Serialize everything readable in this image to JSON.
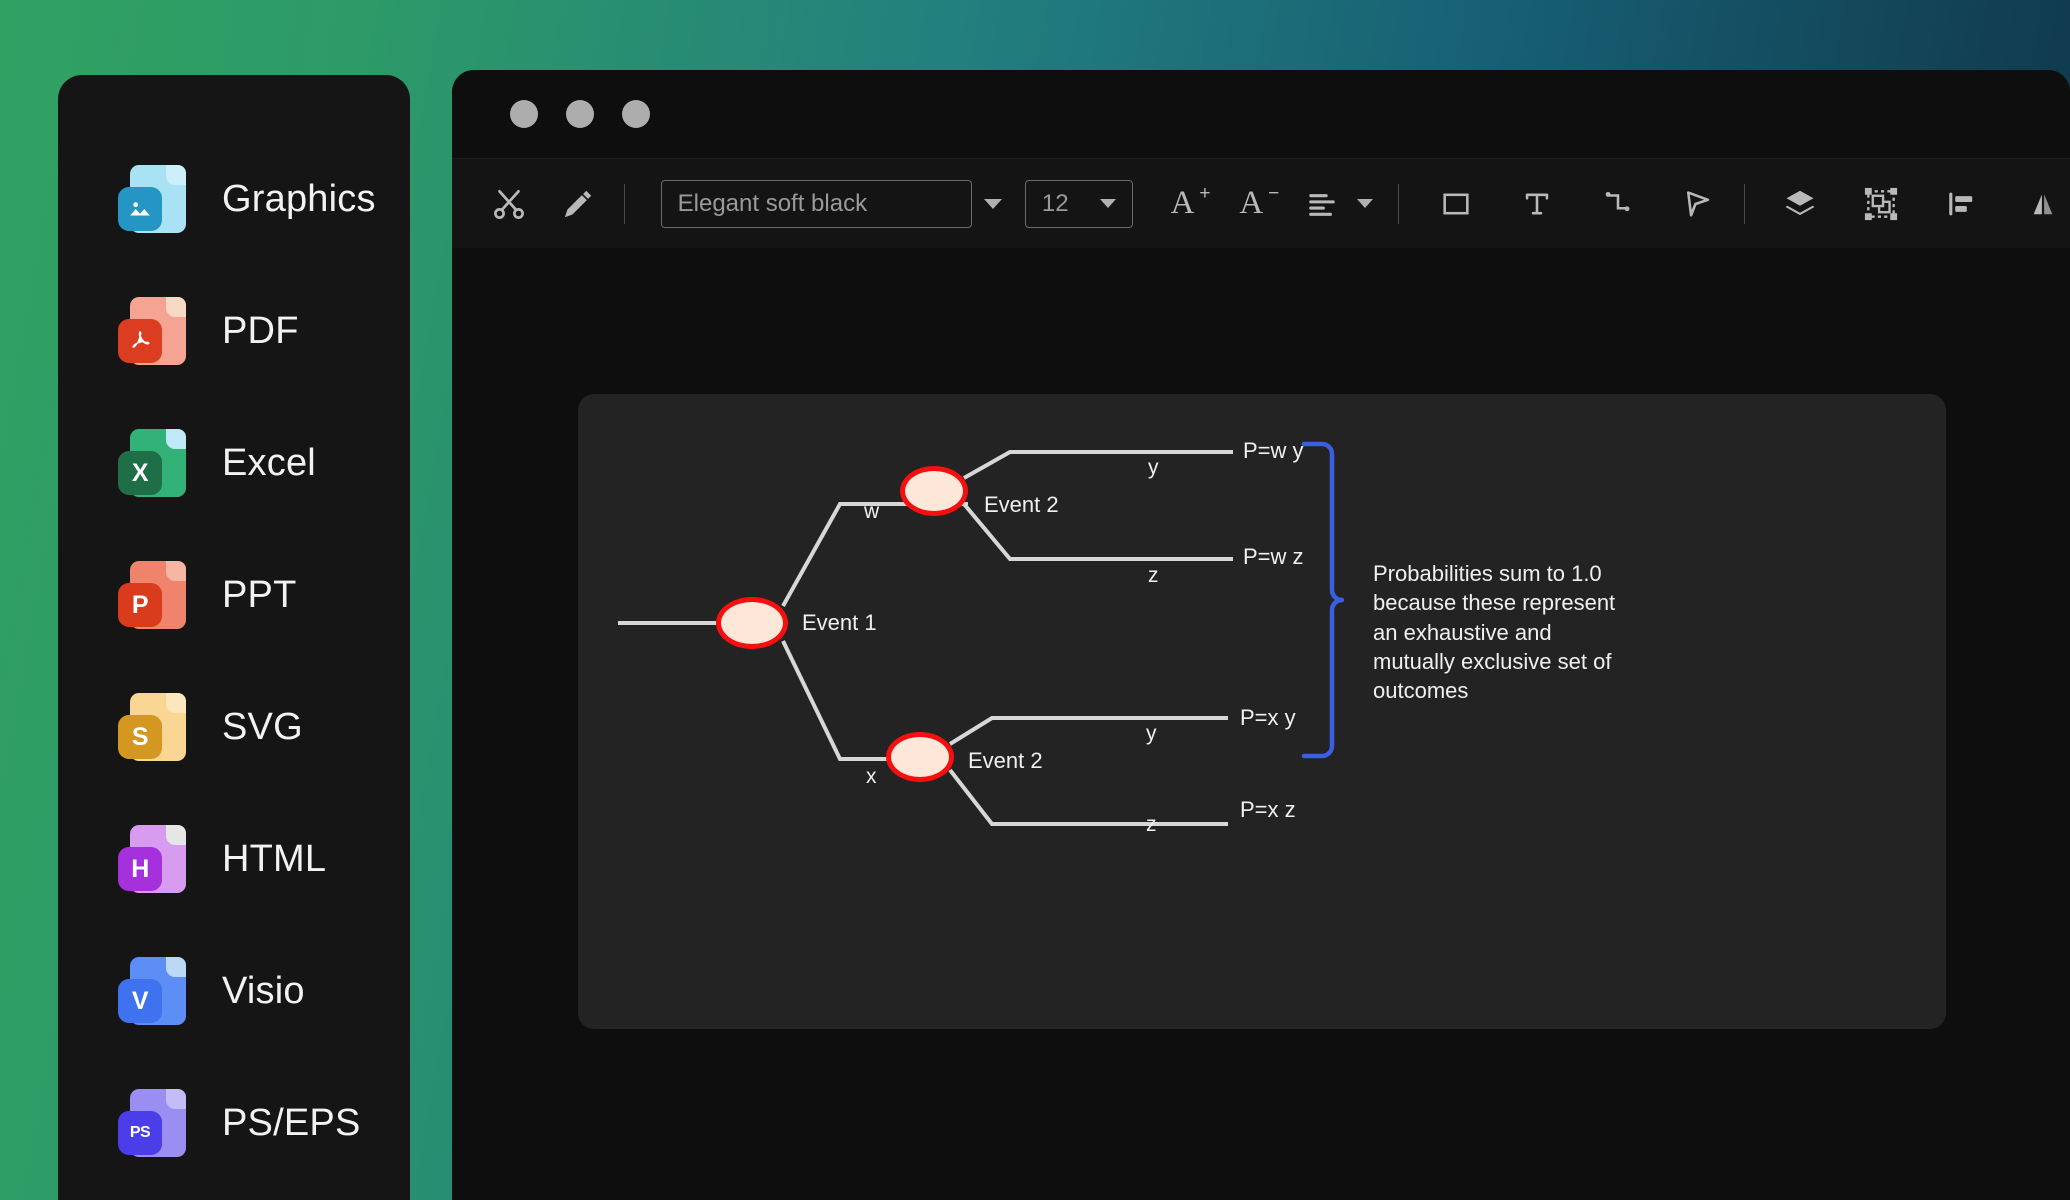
{
  "background": {
    "gradient_from": "#31a163",
    "gradient_to": "#0e3245"
  },
  "sidebar": {
    "items": [
      {
        "label": "Graphics",
        "icon": "graphics-file-icon",
        "badge": "",
        "sheet": "#a9e2f5",
        "fold": "#cdeffb",
        "badge_color": "#2596c4"
      },
      {
        "label": "PDF",
        "icon": "pdf-file-icon",
        "badge": "",
        "sheet": "#f5a393",
        "fold": "#f7d9c4",
        "badge_color": "#da3d20"
      },
      {
        "label": "Excel",
        "icon": "excel-file-icon",
        "badge": "X",
        "sheet": "#33b277",
        "fold": "#bfe9f7",
        "badge_color": "#1e6e47"
      },
      {
        "label": "PPT",
        "icon": "ppt-file-icon",
        "badge": "P",
        "sheet": "#f0836b",
        "fold": "#f7b6a4",
        "badge_color": "#d93b1c"
      },
      {
        "label": "SVG",
        "icon": "svg-file-icon",
        "badge": "S",
        "sheet": "#fad694",
        "fold": "#fbe6bd",
        "badge_color": "#d39722"
      },
      {
        "label": "HTML",
        "icon": "html-file-icon",
        "badge": "H",
        "sheet": "#d79cf0",
        "fold": "#e6e6e6",
        "badge_color": "#a431db"
      },
      {
        "label": "Visio",
        "icon": "visio-file-icon",
        "badge": "V",
        "sheet": "#5d8ef5",
        "fold": "#bcd8f7",
        "badge_color": "#3f72ef"
      },
      {
        "label": "PS/EPS",
        "icon": "ps-eps-file-icon",
        "badge": "PS",
        "sheet": "#9a8ef2",
        "fold": "#c3bcf7",
        "badge_color": "#4b3de8"
      }
    ]
  },
  "window": {
    "traffic_lights": [
      "close-button",
      "minimize-button",
      "maximize-button"
    ]
  },
  "toolbar": {
    "cut_label": "cut-icon",
    "format_painter_label": "format-painter-icon",
    "style_name": "Elegant soft black",
    "style_placeholder": "Elegant soft black",
    "font_size": "12",
    "increase_font_label": "A",
    "increase_font_sup": "+",
    "decrease_font_label": "A",
    "decrease_font_sup": "−",
    "tools": [
      "align-left-icon",
      "rectangle-icon",
      "text-icon",
      "connector-icon",
      "pointer-icon",
      "layers-icon",
      "group-icon",
      "align-objects-icon",
      "flip-icon"
    ]
  },
  "chart_data": {
    "type": "diagram",
    "subtype": "probability-tree",
    "title": "",
    "nodes": [
      {
        "id": "e1",
        "label": "Event 1"
      },
      {
        "id": "e2a",
        "label": "Event 2"
      },
      {
        "id": "e2b",
        "label": "Event 2"
      }
    ],
    "branch_labels": [
      "w",
      "x",
      "y",
      "z",
      "y",
      "z"
    ],
    "outcomes": [
      {
        "label": "P=w y"
      },
      {
        "label": "P=w z"
      },
      {
        "label": "P=x y"
      },
      {
        "label": "P=x z"
      }
    ],
    "annotation": "Probabilities sum to 1.0 because these represent an exhaustive and mutually exclusive set of outcomes",
    "node_fill": "#fde7d9",
    "node_stroke": "#f50f0f",
    "edge_color": "#d7d7d7",
    "brace_color": "#3a5fe0"
  },
  "diagram": {
    "event1": "Event 1",
    "event2_top": "Event 2",
    "event2_bottom": "Event 2",
    "branch_w": "w",
    "branch_x": "x",
    "branch_y_top": "y",
    "branch_z_top": "z",
    "branch_y_bottom": "y",
    "branch_z_bottom": "z",
    "out_wy": "P=w y",
    "out_wz": "P=w z",
    "out_xy": "P=x y",
    "out_xz": "P=x z",
    "annotation": "Probabilities sum to 1.0 because these represent an exhaustive and mutually exclusive set of outcomes"
  }
}
